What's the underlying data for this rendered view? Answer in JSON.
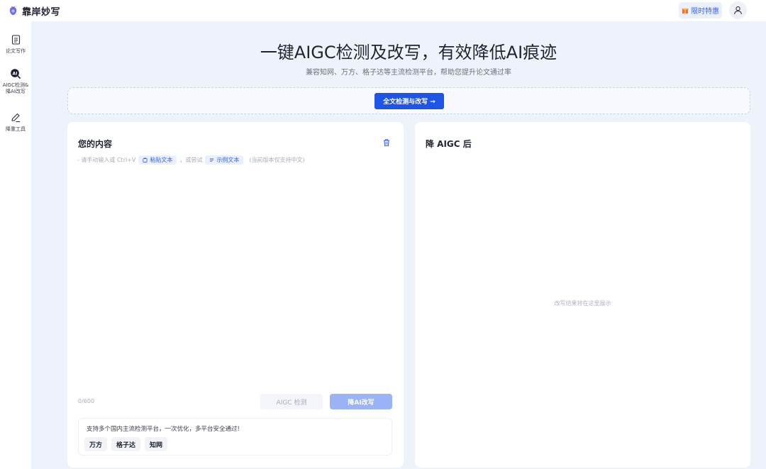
{
  "app": {
    "name": "靠岸妙写",
    "promo_label": "限时特惠"
  },
  "sidebar": {
    "items": [
      {
        "label": "论文写作",
        "icon": "document-icon"
      },
      {
        "label_line1": "AIGC检测&",
        "label_line2": "降AI改写",
        "icon": "ai-search-icon"
      },
      {
        "label": "降重工具",
        "icon": "pen-icon"
      }
    ]
  },
  "hero": {
    "title": "一键AIGC检测及改写，有效降低AI痕迹",
    "subtitle": "兼容知网、万方、格子达等主流检测平台，帮助您提升论文通过率"
  },
  "full_check": {
    "button_label": "全文检测与改写 →"
  },
  "input_panel": {
    "title": "您的内容",
    "hint_prefix": "- 请手动输入或 Ctrl+V",
    "paste_label": "粘贴文本",
    "hint_middle": "，或尝试",
    "example_label": "示例文本",
    "hint_suffix": "(当前版本仅支持中文)",
    "char_count": "0/600",
    "detect_button": "AIGC 检测",
    "rewrite_button": "降AI改写",
    "support_text": "支持多个国内主流检测平台，一次优化，多平台安全通过!",
    "platforms": [
      "万方",
      "格子达",
      "知网"
    ]
  },
  "output_panel": {
    "title": "降 AIGC 后",
    "placeholder": "改写结果将在这里展示"
  },
  "colors": {
    "accent": "#1f55e6",
    "accent_light": "#9ab3f6",
    "chip_bg": "#eaf0ff",
    "page_bg": "#eef2fb"
  }
}
